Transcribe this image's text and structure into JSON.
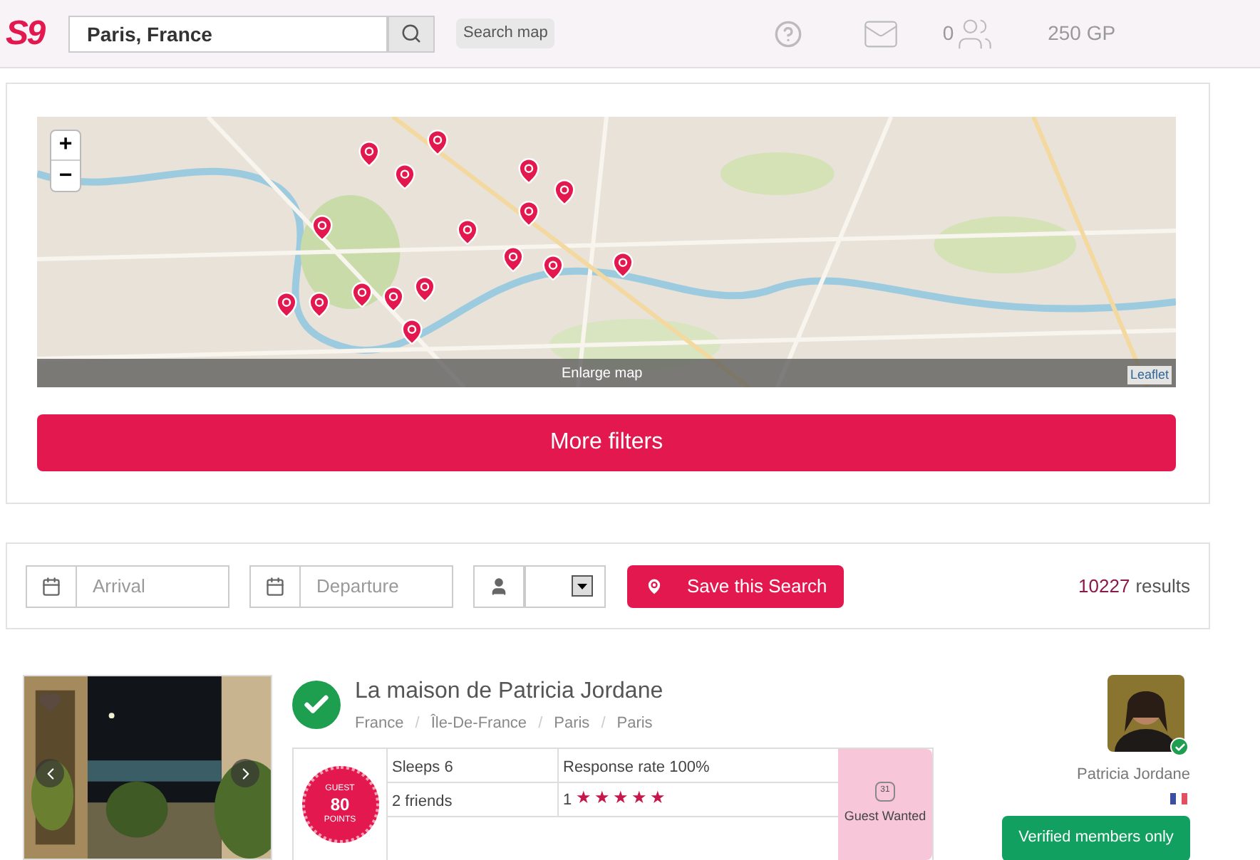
{
  "header": {
    "logo": "S9",
    "search": {
      "value": "Paris, France"
    },
    "search_map_label": "Search map",
    "friends_count": "0",
    "points": "250 GP"
  },
  "map": {
    "zoom_in": "+",
    "zoom_out": "−",
    "enlarge": "Enlarge map",
    "attribution": "Leaflet",
    "more_filters": "More filters"
  },
  "search_bar": {
    "arrival": {
      "placeholder": "Arrival"
    },
    "departure": {
      "placeholder": "Departure"
    },
    "save_button": "Save this Search",
    "results_count": "10227",
    "results_label": "results"
  },
  "listing": {
    "title": "La maison de Patricia Jordane",
    "verified": true,
    "breadcrumb": [
      "France",
      "Île-De-France",
      "Paris",
      "Paris"
    ],
    "breadcrumb_separator": "/",
    "badge": {
      "top": "GUEST",
      "value": "80",
      "bottom": "POINTS"
    },
    "sleeps": "Sleeps 6",
    "response_rate": "Response rate 100%",
    "friends": "2 friends",
    "rating": "1",
    "stars": 5,
    "guest_wanted": "Guest Wanted",
    "calendar_day": "31",
    "host": {
      "name": "Patricia Jordane",
      "verified": true
    },
    "verified_button": "Verified members only"
  }
}
